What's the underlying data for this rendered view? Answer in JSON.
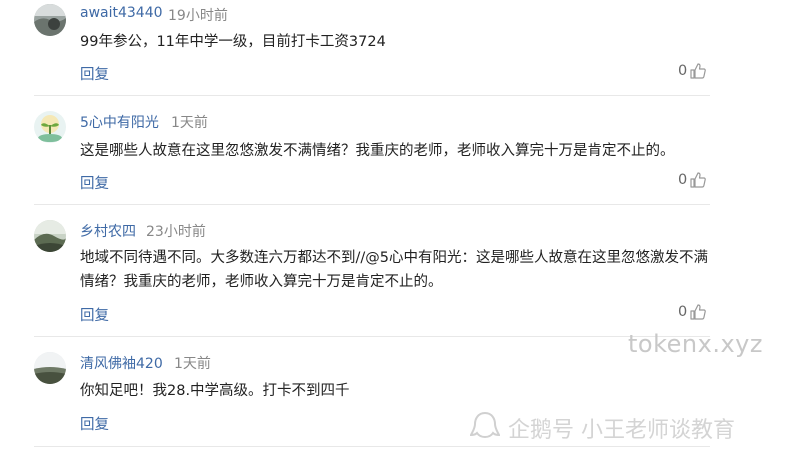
{
  "comments": [
    {
      "username": "await43440",
      "time": "19小时前",
      "content": "99年参公，11年中学一级，目前打卡工资3724",
      "reply_label": "回复",
      "likes": "0"
    },
    {
      "username": "5心中有阳光",
      "time": "1天前",
      "content": "这是哪些人故意在这里忽悠激发不满情绪？我重庆的老师，老师收入算完十万是肯定不止的。",
      "reply_label": "回复",
      "likes": "0"
    },
    {
      "username": "乡村农四",
      "time": "23小时前",
      "content": "地域不同待遇不同。大多数连六万都达不到//@5心中有阳光：这是哪些人故意在这里忽悠激发不满情绪？我重庆的老师，老师收入算完十万是肯定不止的。",
      "reply_label": "回复",
      "likes": "0"
    },
    {
      "username": "清风佛袖420",
      "time": "1天前",
      "content": "你知足吧！我28.中学高级。打卡不到四千",
      "reply_label": "回复"
    }
  ],
  "watermarks": {
    "domain": "tokenx.xyz",
    "brand": "企鹅号 小王老师谈教育"
  },
  "icons": {
    "like": "thumbs-up-icon",
    "watermark_logo": "penguin-logo-icon"
  },
  "colors": {
    "username": "#3f6aa6",
    "time": "#888888",
    "divider": "#e8e8e8"
  }
}
